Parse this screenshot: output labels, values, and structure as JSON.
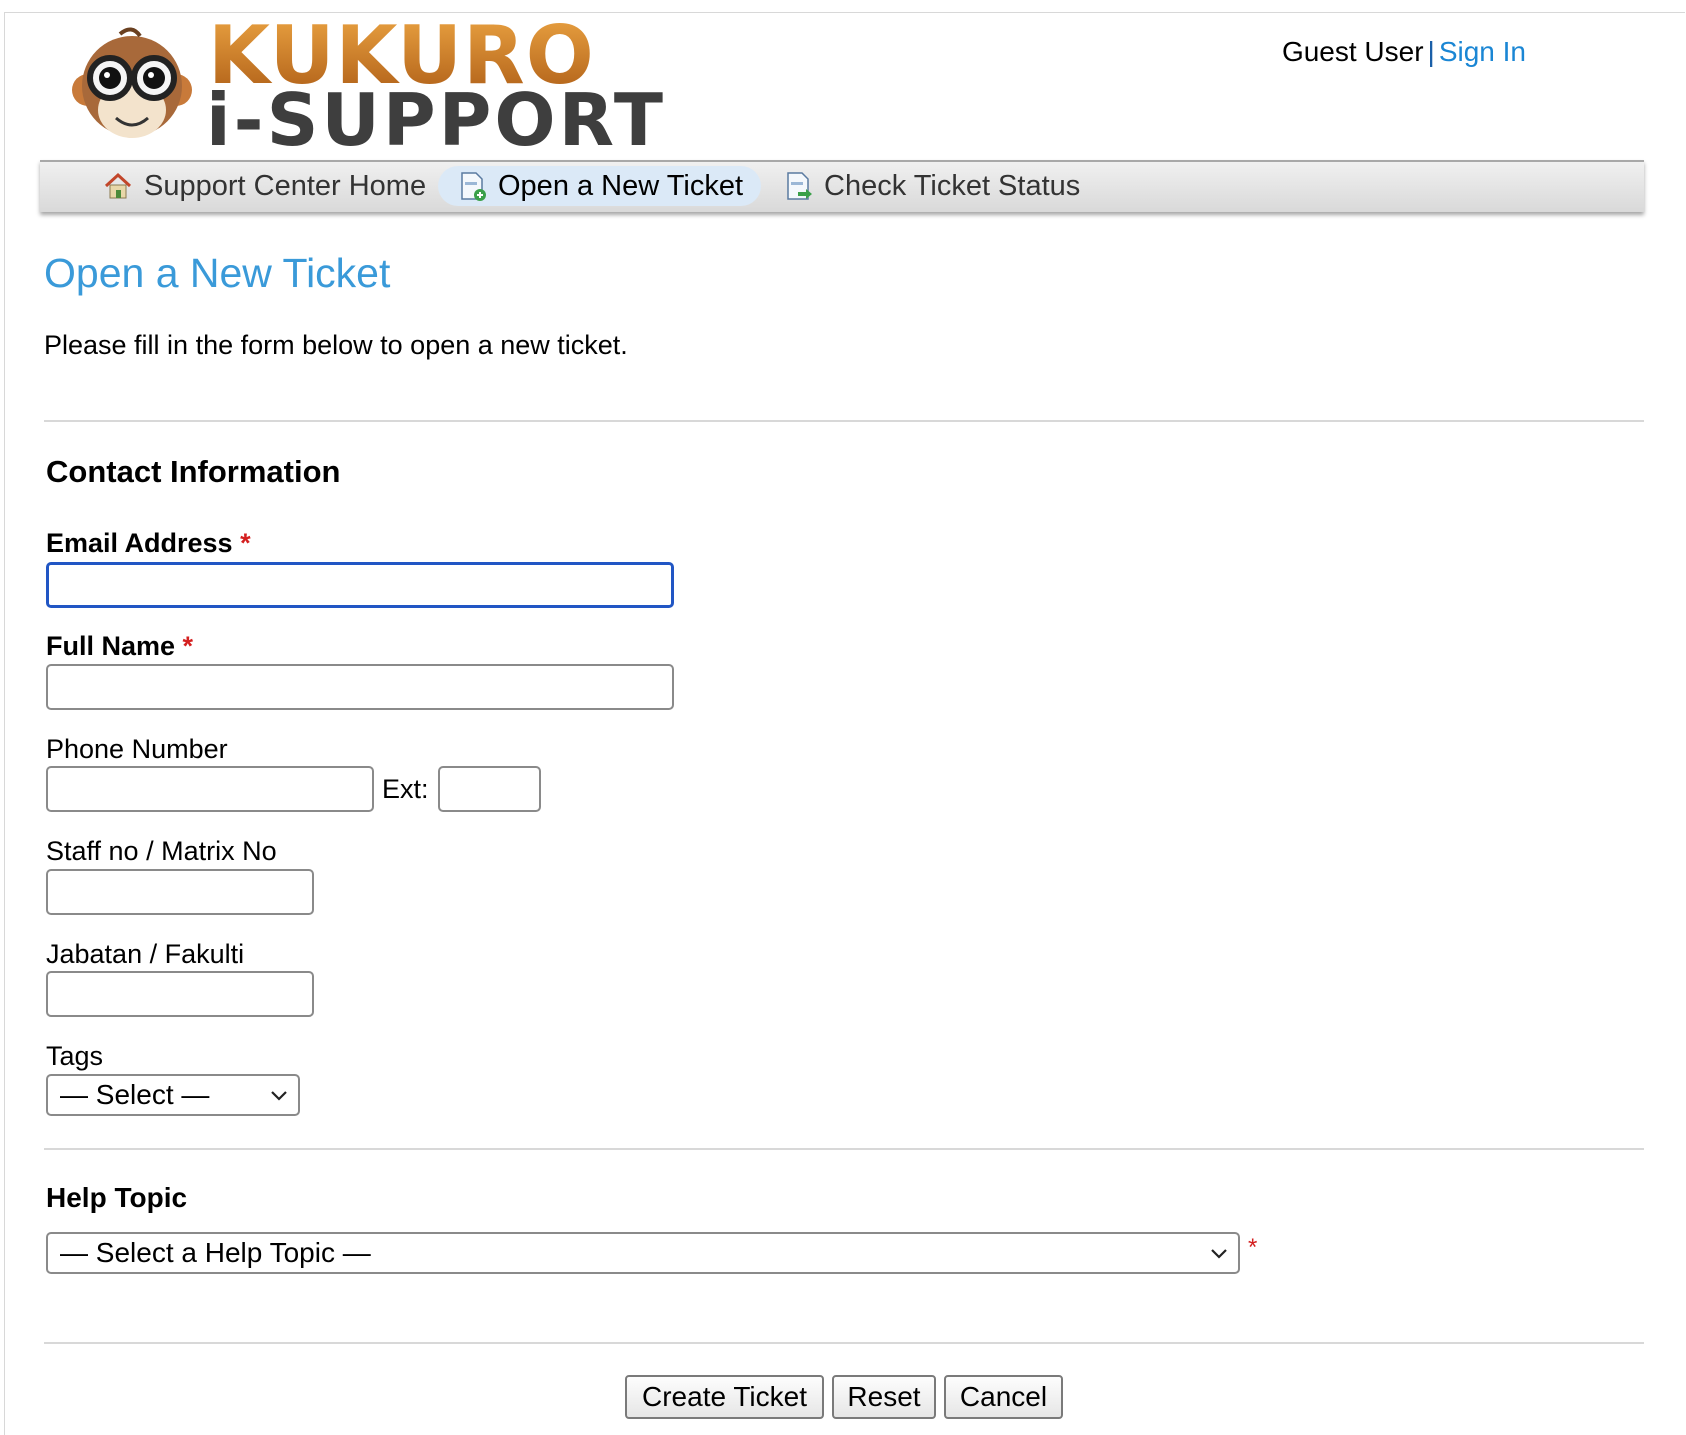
{
  "header": {
    "logo_line1": "KUKURO",
    "logo_line2": "i-SUPPORT",
    "user_name": "Guest User",
    "separator": "|",
    "sign_in_label": "Sign In"
  },
  "nav": {
    "items": [
      {
        "label": "Support Center Home",
        "icon": "home-icon",
        "active": false
      },
      {
        "label": "Open a New Ticket",
        "icon": "new-ticket-icon",
        "active": true
      },
      {
        "label": "Check Ticket Status",
        "icon": "ticket-status-icon",
        "active": false
      }
    ]
  },
  "page": {
    "title": "Open a New Ticket",
    "intro": "Please fill in the form below to open a new ticket."
  },
  "contact": {
    "heading": "Contact Information",
    "email_label": "Email Address",
    "email_value": "",
    "name_label": "Full Name",
    "name_value": "",
    "phone_label": "Phone Number",
    "phone_value": "",
    "ext_label": "Ext:",
    "ext_value": "",
    "staff_label": "Staff no / Matrix No",
    "staff_value": "",
    "dept_label": "Jabatan / Fakulti",
    "dept_value": "",
    "tags_label": "Tags",
    "tags_selected": "— Select —",
    "required_mark": "*"
  },
  "help": {
    "heading": "Help Topic",
    "selected": "— Select a Help Topic —",
    "required_mark": "*"
  },
  "actions": {
    "create_label": "Create Ticket",
    "reset_label": "Reset",
    "cancel_label": "Cancel"
  },
  "colors": {
    "accent": "#3a9ad9",
    "link": "#1a86d4",
    "required": "#d42020",
    "focus_border": "#2156c4"
  }
}
